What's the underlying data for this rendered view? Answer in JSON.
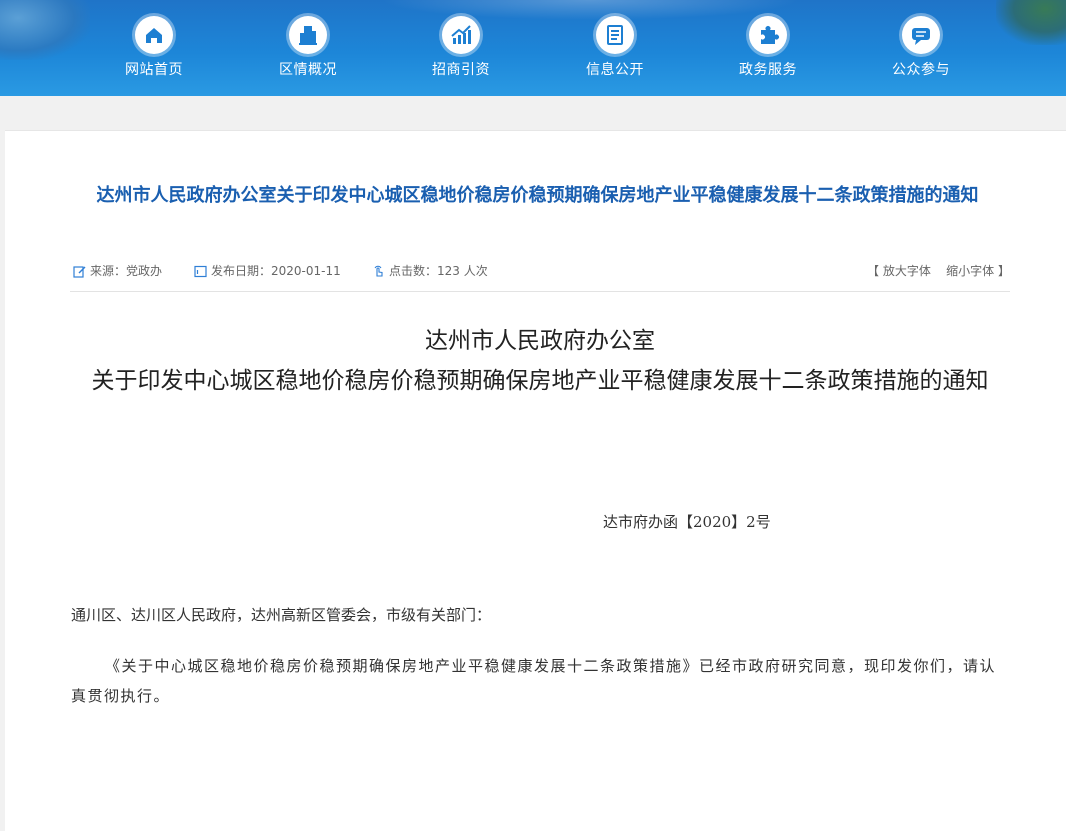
{
  "nav": {
    "items": [
      {
        "label": "网站首页",
        "icon": "home-icon"
      },
      {
        "label": "区情概况",
        "icon": "building-icon"
      },
      {
        "label": "招商引资",
        "icon": "growth-chart-icon"
      },
      {
        "label": "信息公开",
        "icon": "document-icon"
      },
      {
        "label": "政务服务",
        "icon": "puzzle-icon"
      },
      {
        "label": "公众参与",
        "icon": "chat-icon"
      }
    ]
  },
  "article": {
    "title": "达州市人民政府办公室关于印发中心城区稳地价稳房价稳预期确保房地产业平稳健康发展十二条政策措施的通知",
    "meta": {
      "source_label": "来源：",
      "source_value": "党政办",
      "date_label": "发布日期：",
      "date_value": "2020-01-11",
      "clicks_label": "点击数：",
      "clicks_value": "123 人次",
      "font_open": "【",
      "font_larger": "放大字体",
      "font_smaller": "缩小字体",
      "font_close": "】"
    },
    "heading_line1": "达州市人民政府办公室",
    "heading_line2": "关于印发中心城区稳地价稳房价稳预期确保房地产业平稳健康发展十二条政策措施的通知",
    "doc_number": "达市府办函【2020】2号",
    "salutation": "通川区、达川区人民政府，达州高新区管委会，市级有关部门：",
    "body": "《关于中心城区稳地价稳房价稳预期确保房地产业平稳健康发展十二条政策措施》已经市政府研究同意，现印发你们，请认真贯彻执行。"
  },
  "colors": {
    "nav_blue": "#1d86d8",
    "title_blue": "#1a5fb0",
    "meta_icon_blue": "#2f7fd6"
  }
}
